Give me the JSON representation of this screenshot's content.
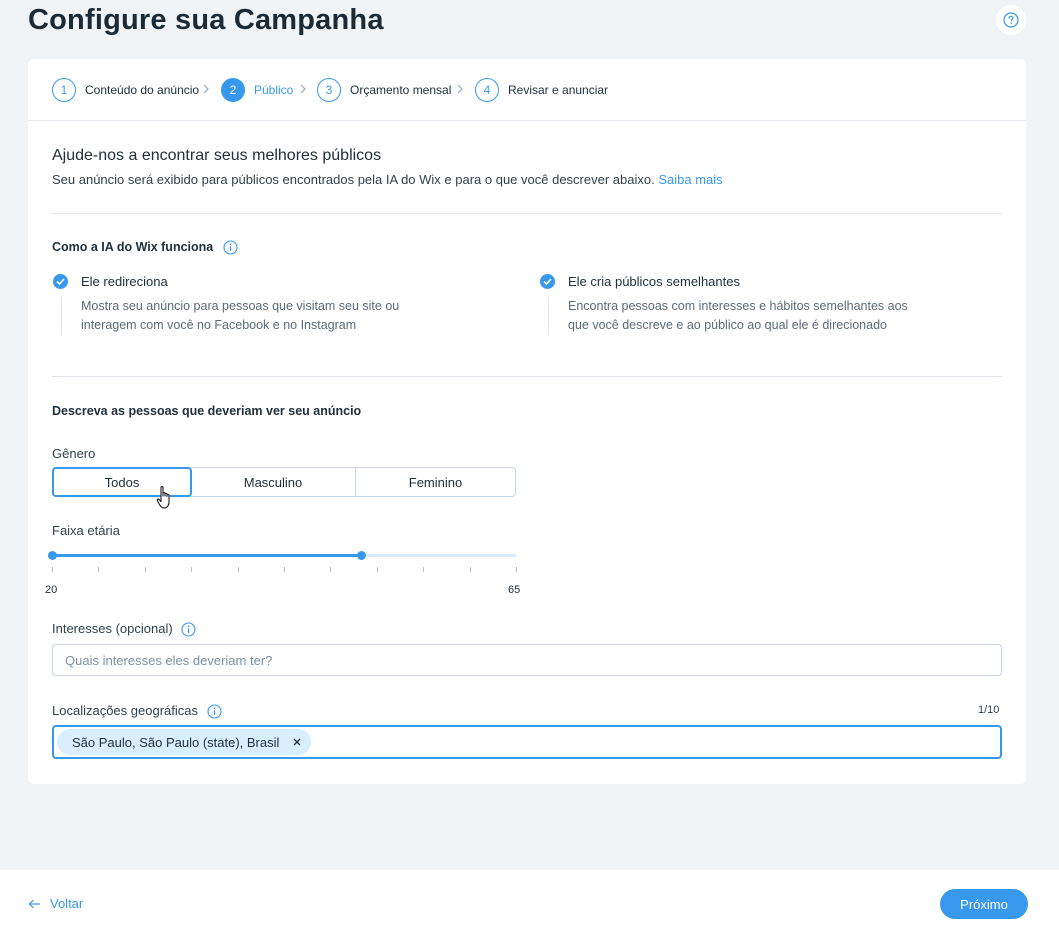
{
  "page": {
    "title": "Configure sua Campanha"
  },
  "icons": {
    "help": "question-circle-icon",
    "info": "info-circle-icon",
    "check": "check-circle-icon",
    "chevron": "chevron-right-icon",
    "back": "arrow-left-icon",
    "remove": "x-icon"
  },
  "colors": {
    "accent": "#3899ec",
    "background": "#f0f4f7",
    "text": "#20303c"
  },
  "stepper": {
    "steps": [
      {
        "num": "1",
        "label": "Conteúdo do anúncio",
        "active": false
      },
      {
        "num": "2",
        "label": "Público",
        "active": true
      },
      {
        "num": "3",
        "label": "Orçamento mensal",
        "active": false
      },
      {
        "num": "4",
        "label": "Revisar e anunciar",
        "active": false
      }
    ]
  },
  "intro": {
    "title": "Ajude-nos a encontrar seus melhores públicos",
    "subtitle": "Seu anúncio será exibido para públicos encontrados pela IA do Wix e para o que você descrever abaixo.",
    "link": "Saiba mais"
  },
  "ai": {
    "title": "Como a IA do Wix funciona",
    "features": [
      {
        "title": "Ele redireciona",
        "desc": "Mostra seu anúncio para pessoas que visitam seu site ou interagem com você no Facebook e no Instagram"
      },
      {
        "title": "Ele cria públicos semelhantes",
        "desc": "Encontra pessoas com interesses e hábitos semelhantes aos que você descreve e ao público ao qual ele é direcionado"
      }
    ]
  },
  "audience": {
    "title": "Descreva as pessoas que deveriam ver seu anúncio",
    "gender": {
      "label": "Gênero",
      "options": [
        "Todos",
        "Masculino",
        "Feminino"
      ],
      "selected": "Todos"
    },
    "age": {
      "label": "Faixa etária",
      "min_label": "20",
      "max_label": "65",
      "min": 20,
      "max": 65,
      "selected_range": [
        20,
        50
      ]
    },
    "interests": {
      "label": "Interesses (opcional)",
      "placeholder": "Quais interesses eles deveriam ter?",
      "value": ""
    },
    "locations": {
      "label": "Localizações geográficas",
      "counter": "1/10",
      "tags": [
        "São Paulo, São Paulo (state), Brasil"
      ]
    }
  },
  "footer": {
    "back_label": "Voltar",
    "next_label": "Próximo"
  }
}
